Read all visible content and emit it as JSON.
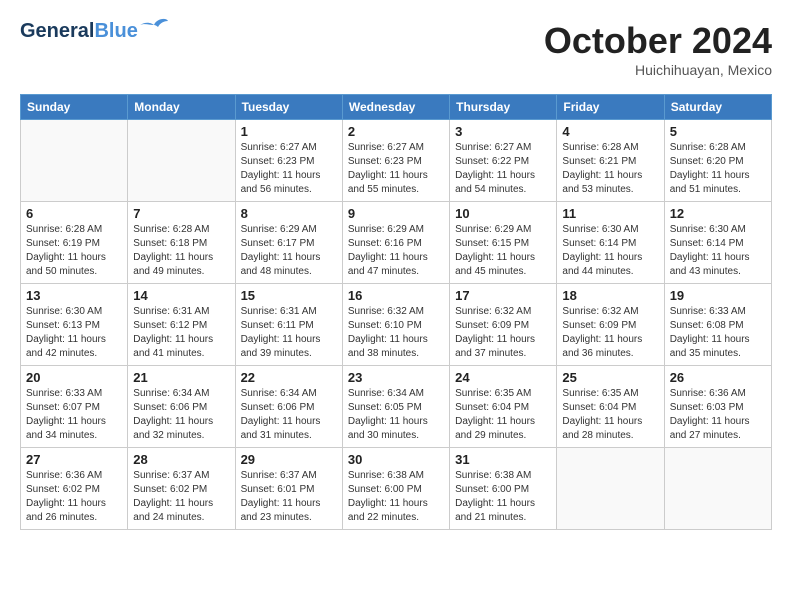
{
  "header": {
    "logo_line1": "General",
    "logo_line2": "Blue",
    "month": "October 2024",
    "location": "Huichihuayan, Mexico"
  },
  "days_of_week": [
    "Sunday",
    "Monday",
    "Tuesday",
    "Wednesday",
    "Thursday",
    "Friday",
    "Saturday"
  ],
  "weeks": [
    [
      {
        "day": "",
        "info": ""
      },
      {
        "day": "",
        "info": ""
      },
      {
        "day": "1",
        "info": "Sunrise: 6:27 AM\nSunset: 6:23 PM\nDaylight: 11 hours and 56 minutes."
      },
      {
        "day": "2",
        "info": "Sunrise: 6:27 AM\nSunset: 6:23 PM\nDaylight: 11 hours and 55 minutes."
      },
      {
        "day": "3",
        "info": "Sunrise: 6:27 AM\nSunset: 6:22 PM\nDaylight: 11 hours and 54 minutes."
      },
      {
        "day": "4",
        "info": "Sunrise: 6:28 AM\nSunset: 6:21 PM\nDaylight: 11 hours and 53 minutes."
      },
      {
        "day": "5",
        "info": "Sunrise: 6:28 AM\nSunset: 6:20 PM\nDaylight: 11 hours and 51 minutes."
      }
    ],
    [
      {
        "day": "6",
        "info": "Sunrise: 6:28 AM\nSunset: 6:19 PM\nDaylight: 11 hours and 50 minutes."
      },
      {
        "day": "7",
        "info": "Sunrise: 6:28 AM\nSunset: 6:18 PM\nDaylight: 11 hours and 49 minutes."
      },
      {
        "day": "8",
        "info": "Sunrise: 6:29 AM\nSunset: 6:17 PM\nDaylight: 11 hours and 48 minutes."
      },
      {
        "day": "9",
        "info": "Sunrise: 6:29 AM\nSunset: 6:16 PM\nDaylight: 11 hours and 47 minutes."
      },
      {
        "day": "10",
        "info": "Sunrise: 6:29 AM\nSunset: 6:15 PM\nDaylight: 11 hours and 45 minutes."
      },
      {
        "day": "11",
        "info": "Sunrise: 6:30 AM\nSunset: 6:14 PM\nDaylight: 11 hours and 44 minutes."
      },
      {
        "day": "12",
        "info": "Sunrise: 6:30 AM\nSunset: 6:14 PM\nDaylight: 11 hours and 43 minutes."
      }
    ],
    [
      {
        "day": "13",
        "info": "Sunrise: 6:30 AM\nSunset: 6:13 PM\nDaylight: 11 hours and 42 minutes."
      },
      {
        "day": "14",
        "info": "Sunrise: 6:31 AM\nSunset: 6:12 PM\nDaylight: 11 hours and 41 minutes."
      },
      {
        "day": "15",
        "info": "Sunrise: 6:31 AM\nSunset: 6:11 PM\nDaylight: 11 hours and 39 minutes."
      },
      {
        "day": "16",
        "info": "Sunrise: 6:32 AM\nSunset: 6:10 PM\nDaylight: 11 hours and 38 minutes."
      },
      {
        "day": "17",
        "info": "Sunrise: 6:32 AM\nSunset: 6:09 PM\nDaylight: 11 hours and 37 minutes."
      },
      {
        "day": "18",
        "info": "Sunrise: 6:32 AM\nSunset: 6:09 PM\nDaylight: 11 hours and 36 minutes."
      },
      {
        "day": "19",
        "info": "Sunrise: 6:33 AM\nSunset: 6:08 PM\nDaylight: 11 hours and 35 minutes."
      }
    ],
    [
      {
        "day": "20",
        "info": "Sunrise: 6:33 AM\nSunset: 6:07 PM\nDaylight: 11 hours and 34 minutes."
      },
      {
        "day": "21",
        "info": "Sunrise: 6:34 AM\nSunset: 6:06 PM\nDaylight: 11 hours and 32 minutes."
      },
      {
        "day": "22",
        "info": "Sunrise: 6:34 AM\nSunset: 6:06 PM\nDaylight: 11 hours and 31 minutes."
      },
      {
        "day": "23",
        "info": "Sunrise: 6:34 AM\nSunset: 6:05 PM\nDaylight: 11 hours and 30 minutes."
      },
      {
        "day": "24",
        "info": "Sunrise: 6:35 AM\nSunset: 6:04 PM\nDaylight: 11 hours and 29 minutes."
      },
      {
        "day": "25",
        "info": "Sunrise: 6:35 AM\nSunset: 6:04 PM\nDaylight: 11 hours and 28 minutes."
      },
      {
        "day": "26",
        "info": "Sunrise: 6:36 AM\nSunset: 6:03 PM\nDaylight: 11 hours and 27 minutes."
      }
    ],
    [
      {
        "day": "27",
        "info": "Sunrise: 6:36 AM\nSunset: 6:02 PM\nDaylight: 11 hours and 26 minutes."
      },
      {
        "day": "28",
        "info": "Sunrise: 6:37 AM\nSunset: 6:02 PM\nDaylight: 11 hours and 24 minutes."
      },
      {
        "day": "29",
        "info": "Sunrise: 6:37 AM\nSunset: 6:01 PM\nDaylight: 11 hours and 23 minutes."
      },
      {
        "day": "30",
        "info": "Sunrise: 6:38 AM\nSunset: 6:00 PM\nDaylight: 11 hours and 22 minutes."
      },
      {
        "day": "31",
        "info": "Sunrise: 6:38 AM\nSunset: 6:00 PM\nDaylight: 11 hours and 21 minutes."
      },
      {
        "day": "",
        "info": ""
      },
      {
        "day": "",
        "info": ""
      }
    ]
  ]
}
